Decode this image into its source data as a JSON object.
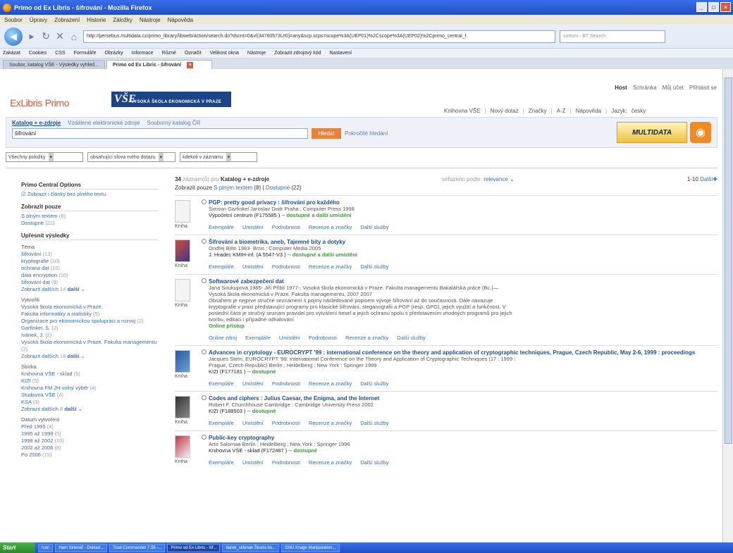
{
  "window": {
    "title": "Primo od Ex Libris - šifrování - Mozilla Firefox"
  },
  "menu": [
    "Soubor",
    "Úpravy",
    "Zobrazení",
    "Historie",
    "Záložky",
    "Nástroje",
    "Nápověda"
  ],
  "url": "http://persebus.multidata.cz/primo_library/libweb/action/search.do?dscnt=0&vl(34760573UI0)=any&scp.scps=scope%3A(UEP01)%2Cscope%3A(UEP02)%2Cprimo_central_t",
  "websearch": "sortuni - BT Search",
  "bookmarks": [
    "Zakázat",
    "Cookies",
    "CSS",
    "Formuláře",
    "Obrázky",
    "Informace",
    "Různé",
    "Označit",
    "Velikost okna",
    "Nástroje",
    "Zobrazit zdrojový kód",
    "Nastavení"
  ],
  "tabs": [
    {
      "label": "Soubor, katalog VŠE - Výsledky vyhled..."
    },
    {
      "label": "Primo od Ex Libris - šifrování"
    }
  ],
  "toplinks": {
    "guest": "Host",
    "basket": "Schránka",
    "account": "Můj účet",
    "login": "Přihlásit se"
  },
  "logo": {
    "brand": "ExLibris",
    "product": "Primo",
    "vse_label": "VYSOKÁ ŠKOLA EKONOMICKÁ V PRAZE"
  },
  "rightnav": [
    "Knihovna VŠE",
    "Nový dotaz",
    "Značky",
    "A-Z",
    "Nápověda",
    "Jazyk:",
    "česky"
  ],
  "search": {
    "tabs": [
      "Katalog + e-zdroje",
      "Vzdálené elektronické zdroje",
      "Souborný katalog ČR"
    ],
    "query": "šifrování",
    "button": "Hledat",
    "advanced": "Pokročilé hledání",
    "multi": "MULTIDATA"
  },
  "filters": [
    "Všechny položky",
    "obsahující slova mého dotazu",
    "kdekoli v záznamu"
  ],
  "sidebar": {
    "pc_title": "Primo Central Options",
    "pc_link": "Zobrazit i články bez plného textu",
    "show_title": "Zobrazit pouze",
    "show": [
      {
        "label": "S plným textem",
        "count": "(8)"
      },
      {
        "label": "Dostupné",
        "count": "(22)"
      }
    ],
    "refine_title": "Upřesnit výsledky",
    "groups": [
      {
        "name": "Téma",
        "items": [
          {
            "label": "šifrování",
            "count": "(13)"
          },
          {
            "label": "kryptografie",
            "count": "(10)"
          },
          {
            "label": "ochrana dat",
            "count": "(10)"
          },
          {
            "label": "data encryption",
            "count": "(10)"
          },
          {
            "label": "šifrování dat",
            "count": "(9)"
          }
        ],
        "more": "Zobrazit dalších",
        "morecount": "14",
        "moreb": "další"
      },
      {
        "name": "Vytvořili",
        "items": [
          {
            "label": "Vysoká škola ekonomická v Praze.",
            "count": ""
          },
          {
            "label": "Fakulta informatiky a statistiky",
            "count": "(5)"
          },
          {
            "label": "Organizace pro ekonomickou spolupráci a rozvoj",
            "count": "(2)"
          },
          {
            "label": "Garfinkel, S.",
            "count": "(2)"
          },
          {
            "label": "Ivánek, J.",
            "count": "(2)"
          },
          {
            "label": "Vysoká škola ekonomická v Praze. Fakulta managementu",
            "count": "(2)"
          }
        ],
        "more": "Zobrazit dalších",
        "morecount": "16",
        "moreb": "další"
      },
      {
        "name": "Sbírka",
        "items": [
          {
            "label": "Knihovna VŠE - sklad",
            "count": "(5)"
          },
          {
            "label": "KIZI",
            "count": "(5)"
          },
          {
            "label": "Knihovna FM JH volný výběr",
            "count": "(4)"
          },
          {
            "label": "Studovna VŠE",
            "count": "(4)"
          },
          {
            "label": "KSA",
            "count": "(3)"
          }
        ],
        "more": "Zobrazit dalších",
        "morecount": "8",
        "moreb": "další"
      },
      {
        "name": "Datum vytvoření",
        "items": [
          {
            "label": "Před 1995",
            "count": "(4)"
          },
          {
            "label": "1995 až 1998",
            "count": "(5)"
          },
          {
            "label": "1998 až 2002",
            "count": "(10)"
          },
          {
            "label": "2002 až 2006",
            "count": "(8)"
          },
          {
            "label": "Po 2006",
            "count": "(15)"
          }
        ],
        "more": "",
        "morecount": "",
        "moreb": ""
      }
    ]
  },
  "results": {
    "count": "34",
    "count_label": "záznam(ů) pro",
    "scope": "Katalog + e-zdroje",
    "sorted_label": "seřazeno podle:",
    "sort": "relevance",
    "paging": "1-10",
    "next": "Další",
    "showonly_label": "Zobrazit pouze",
    "showonly": [
      {
        "label": "S plným textem",
        "count": "(8)"
      },
      {
        "label": "Dostupné",
        "count": "(22)"
      }
    ],
    "records": [
      {
        "title": "PGP: pretty good privacy : šifrování pro každého",
        "lines": [
          "Simson Garfinkel Jaroslav Dudr Praha : Computer Press 1998"
        ],
        "loc": "Výpočetní centrum  (F175585 ) --",
        "avail": "dostupné a další umístění",
        "kind": "Kniha",
        "actions": [
          "Exempláře",
          "Umístění",
          "Podrobnosti",
          "Recenze a značky",
          "Další služby"
        ]
      },
      {
        "title": "Šifrování a biometrika, aneb, Tajemné bity a dotyky",
        "lines": [
          "Ondřej Bitto 1983- Brno : Computer Media 2005"
        ],
        "loc": "J. Hradec KMIH-inf.  (A 5547-V3 ) --",
        "avail": "dostupné a další umístění",
        "kind": "Kniha",
        "actions": [
          "Exempláře",
          "Umístění",
          "Podrobnosti",
          "Recenze a značky",
          "Další služby"
        ]
      },
      {
        "title": "Softwarové zabezpečení dat",
        "lines": [
          "Jana Soukupová 1985- Jiří Přibil 1977-; Vysoká škola ekonomická v Praze. Fakulta managementu Bakalářská práce (Bc.)—",
          "Vysoká škola ekonomická v Praze. Fakulta managementu, 2007 2007",
          "Obsahem je nejprve stručné seznámení s pojmy následované popisem vývoje šifrování až do současnosti. Dále navazuje",
          "kryptografie v praxi představující programy pro klasické šifrování, steganografii a PGP (resp. GPG), jejich využití a funkčnost. V",
          "poslední části je stručný seznam pravidel pro vytváření hesel a jejich ochranu spolu s představením vhodných programů pro jejich",
          "tvorbu, editaci i případné odhalování"
        ],
        "online": "Online přístup",
        "loc": "",
        "avail": "",
        "kind": "Kniha",
        "actions": [
          "Online zdroj",
          "Exempláře",
          "Umístění",
          "Podrobnosti",
          "Recenze a značky",
          "Další služby"
        ]
      },
      {
        "title": "Advances in cryptology - EUROCRYPT '99 : international conference on the theory and application of cryptographic techniques, Prague, Czech Republic, May 2-6, 1999 : proceedings",
        "lines": [
          "Jacques Stern; EUROCRYPT '99: International Conference on the Theory and Application of Cryptographic Techniques (17 : 1999 :",
          "Prague, Czech Republic) Berlin ; Heidelberg ; New York : Springer 1999"
        ],
        "loc": "KIZI  (F177181 ) --",
        "avail": "dostupné",
        "kind": "Kniha",
        "actions": [
          "Exempláře",
          "Umístění",
          "Podrobnosti",
          "Recenze a značky",
          "Další služby"
        ]
      },
      {
        "title": "Codes and ciphers : Julius Caesar, the Enigma, and the Internet",
        "lines": [
          "Robert F. Churchhouse Cambridge : Cambridge University Press 2002"
        ],
        "loc": "KIZI  (F188503 ) --",
        "avail": "dostupné",
        "kind": "Kniha",
        "actions": [
          "Exempláře",
          "Umístění",
          "Podrobnosti",
          "Recenze a značky",
          "Další služby"
        ]
      },
      {
        "title": "Public-key cryptography",
        "lines": [
          "Arto Salomaa Berlin ; Heidelberg ; New York : Springer 1996"
        ],
        "loc": "Knihovna VŠE - sklad  (F172487 ) --",
        "avail": "dostupné",
        "kind": "Kniha",
        "actions": [
          "Exempláře",
          "Umístění",
          "Podrobnosti",
          "Recenze a značky",
          "Další služby"
        ]
      }
    ]
  },
  "taskbar": {
    "start": "Start",
    "items": [
      "Icon",
      "Ham Sklenář - Doklad...",
      "Total Commander 7.55 -...",
      "Primo od Ex Libris - šif...",
      "darek_sklenak Škoda bo...",
      "GNU Image Manipulation..."
    ]
  }
}
